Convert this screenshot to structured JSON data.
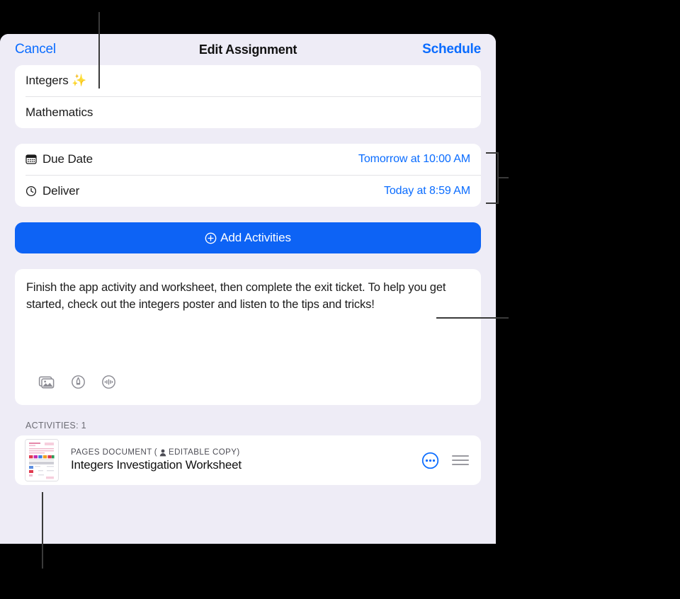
{
  "nav": {
    "cancel_label": "Cancel",
    "title": "Edit Assignment",
    "schedule_label": "Schedule"
  },
  "fields": {
    "title_value": "Integers ✨",
    "subject_value": "Mathematics"
  },
  "dates": [
    {
      "icon": "calendar-icon",
      "label": "Due Date",
      "value": "Tomorrow at 10:00 AM"
    },
    {
      "icon": "clock-icon",
      "label": "Deliver",
      "value": "Today at 8:59 AM"
    }
  ],
  "add_activities": {
    "icon": "plus-circle-icon",
    "label": "Add Activities"
  },
  "description": {
    "text": "Finish the app activity and worksheet, then complete the exit ticket. To help you get started, check out the integers poster and listen to the tips and tricks!",
    "toolbar": [
      {
        "icon": "photos-icon",
        "name": "insert-photo-button"
      },
      {
        "icon": "markup-icon",
        "name": "insert-markup-button"
      },
      {
        "icon": "audio-icon",
        "name": "insert-audio-button"
      }
    ]
  },
  "activities": {
    "header": "ACTIVITIES: 1",
    "items": [
      {
        "kind": "PAGES DOCUMENT",
        "copy_badge_icon": "person-icon",
        "copy_badge": "EDITABLE COPY)",
        "copy_badge_open": "(",
        "title": "Integers Investigation Worksheet",
        "more_icon": "more-circle-icon",
        "drag_icon": "drag-handle-icon"
      }
    ]
  },
  "colors": {
    "accent_blue": "#0a6cff",
    "button_blue": "#0d63f5",
    "sheet_bg": "#eeecf6",
    "card_bg": "#ffffff",
    "backdrop": "#000000"
  }
}
